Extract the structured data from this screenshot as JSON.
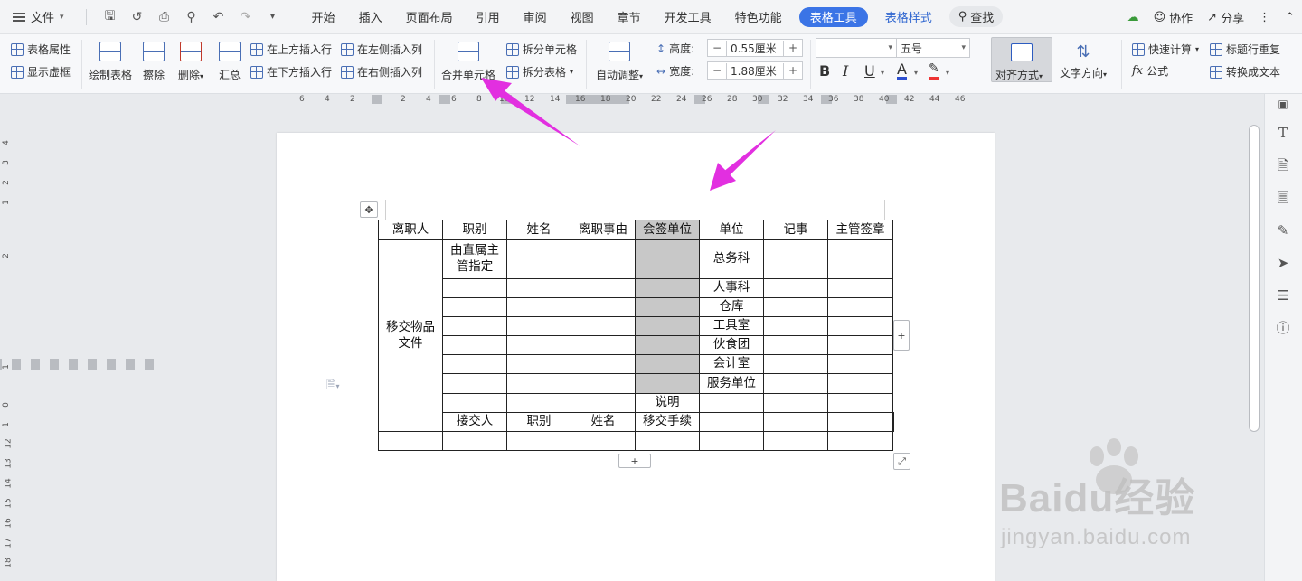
{
  "menubar": {
    "file_label": "文件",
    "tabs": [
      "开始",
      "插入",
      "页面布局",
      "引用",
      "审阅",
      "视图",
      "章节",
      "开发工具",
      "特色功能"
    ],
    "active_tab": "表格工具",
    "blue_tab": "表格样式",
    "search": "查找",
    "collab": "协作",
    "share": "分享"
  },
  "ribbon": {
    "table_props": "表格属性",
    "show_gridlines": "显示虚框",
    "draw_table": "绘制表格",
    "erase": "擦除",
    "delete": "删除",
    "summary": "汇总",
    "insert_above": "在上方插入行",
    "insert_below": "在下方插入行",
    "insert_left": "在左侧插入列",
    "insert_right": "在右侧插入列",
    "merge_cells": "合并单元格",
    "split_cells": "拆分单元格",
    "split_table": "拆分表格",
    "auto_fit": "自动调整",
    "height_label": "高度:",
    "height_value": "0.55厘米",
    "width_label": "宽度:",
    "width_value": "1.88厘米",
    "font_size": "五号",
    "align": "对齐方式",
    "text_direction": "文字方向",
    "quick_calc": "快速计算",
    "formula": "公式",
    "repeat_header": "标题行重复",
    "convert_text": "转换成文本"
  },
  "ruler": {
    "h_ticks": [
      "6",
      "4",
      "2",
      "2",
      "4",
      "6",
      "8",
      "10",
      "12",
      "14",
      "16",
      "18",
      "20",
      "22",
      "24",
      "26",
      "28",
      "30",
      "32",
      "34",
      "36",
      "38",
      "40",
      "42",
      "44",
      "46"
    ],
    "v_ticks": [
      "4",
      "3",
      "2",
      "1",
      "2",
      "1",
      "0",
      "1",
      "12",
      "13",
      "14",
      "15",
      "16",
      "17",
      "18"
    ]
  },
  "table": {
    "header": [
      "离职人",
      "职别",
      "姓名",
      "离职事由",
      "会签单位",
      "单位",
      "记事",
      "主管签章"
    ],
    "row_label": "移交物品文件",
    "first_cell": "由直属主管指定",
    "units": [
      "总务科",
      "人事科",
      "仓库",
      "工具室",
      "伙食团",
      "会计室",
      "服务单位"
    ],
    "note": "说明",
    "footer": [
      "接交人",
      "职别",
      "姓名",
      "移交手续"
    ]
  },
  "watermark": {
    "logo": "Baidu经验",
    "url": "jingyan.baidu.com"
  },
  "colors": {
    "accent": "#3b74e6",
    "arrow": "#e22fe0",
    "gray_cell": "#c8c8c8"
  }
}
